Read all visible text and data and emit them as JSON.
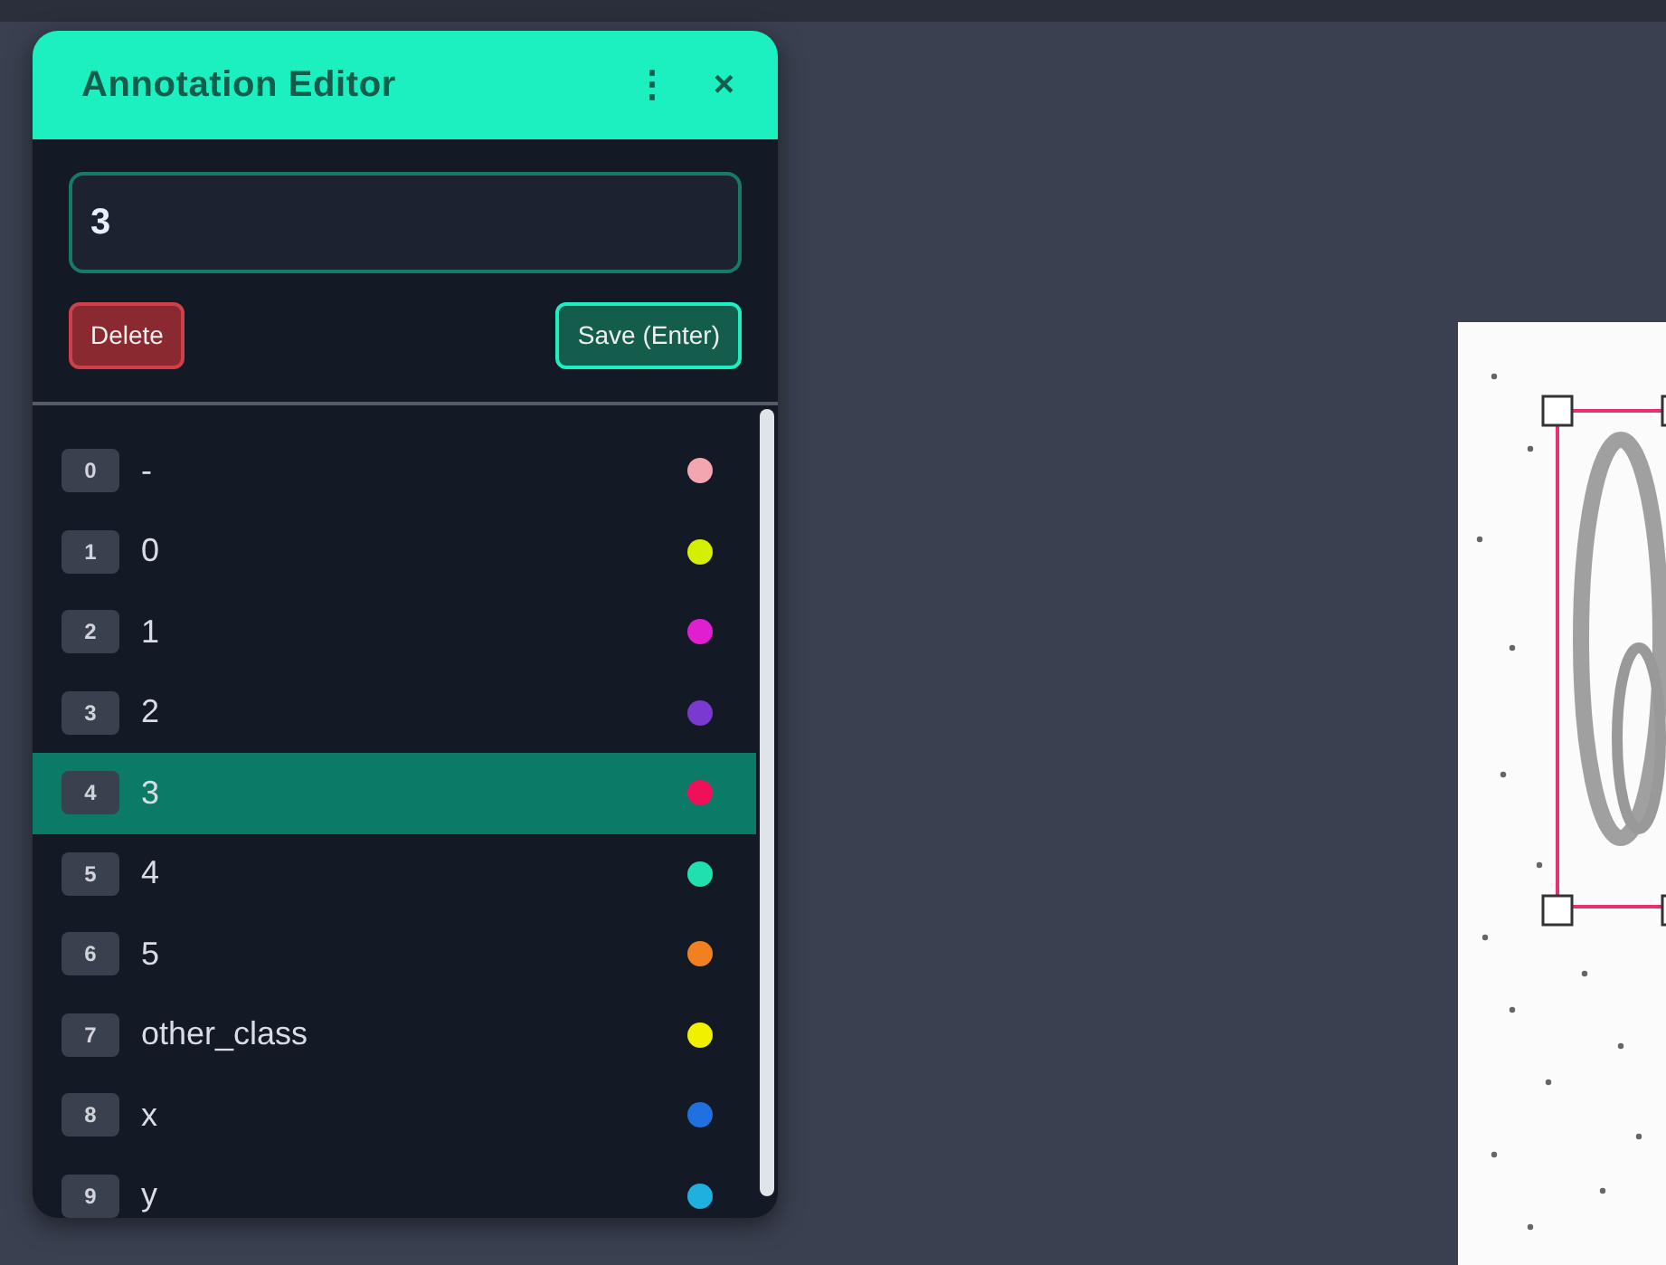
{
  "panel": {
    "title": "Annotation Editor",
    "menu_icon": "⋮",
    "close_icon": "×"
  },
  "label_field": {
    "value": "3"
  },
  "buttons": [
    {
      "kind": "danger",
      "label": "Delete"
    },
    {
      "kind": "primary",
      "label": "Save (Enter)"
    }
  ],
  "classes": [
    {
      "index": "0",
      "label": "-",
      "color": "#f4a6b0",
      "selected": false
    },
    {
      "index": "1",
      "label": "0",
      "color": "#d4f000",
      "selected": false
    },
    {
      "index": "2",
      "label": "1",
      "color": "#e020d0",
      "selected": false
    },
    {
      "index": "3",
      "label": "2",
      "color": "#7a3ad0",
      "selected": false
    },
    {
      "index": "4",
      "label": "3",
      "color": "#f0105a",
      "selected": true
    },
    {
      "index": "5",
      "label": "4",
      "color": "#20e0b0",
      "selected": false
    },
    {
      "index": "6",
      "label": "5",
      "color": "#f08020",
      "selected": false
    },
    {
      "index": "7",
      "label": "other_class",
      "color": "#f0f000",
      "selected": false
    },
    {
      "index": "8",
      "label": "x",
      "color": "#2070e0",
      "selected": false
    },
    {
      "index": "9",
      "label": "y",
      "color": "#20b0e0",
      "selected": false
    }
  ]
}
